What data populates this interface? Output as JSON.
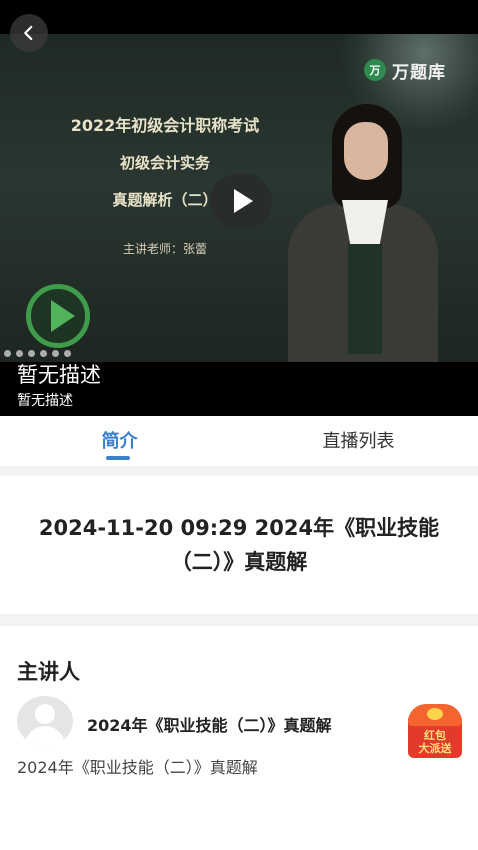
{
  "video": {
    "brand_mark": "万",
    "brand_name": "万题库",
    "slide_line1": "2022年初级会计职称考试",
    "slide_line2": "初级会计实务",
    "slide_line3": "真题解析（二）",
    "slide_line4": "主讲老师：张蕾"
  },
  "caption": {
    "title": "暂无描述",
    "subtitle": "暂无描述"
  },
  "tabs": [
    {
      "label": "简介",
      "active": true
    },
    {
      "label": "直播列表",
      "active": false
    }
  ],
  "lesson": {
    "title": "2024-11-20 09:29 2024年《职业技能（二）》真题解"
  },
  "speaker": {
    "heading": "主讲人",
    "name": "2024年《职业技能（二）》真题解",
    "description": "2024年《职业技能（二）》真题解"
  },
  "red_packet": {
    "line1": "红包",
    "line2": "大派送"
  },
  "colors": {
    "accent": "#3a7fce",
    "divider": "#f2f3f5",
    "red_packet": "#e23a2b"
  }
}
